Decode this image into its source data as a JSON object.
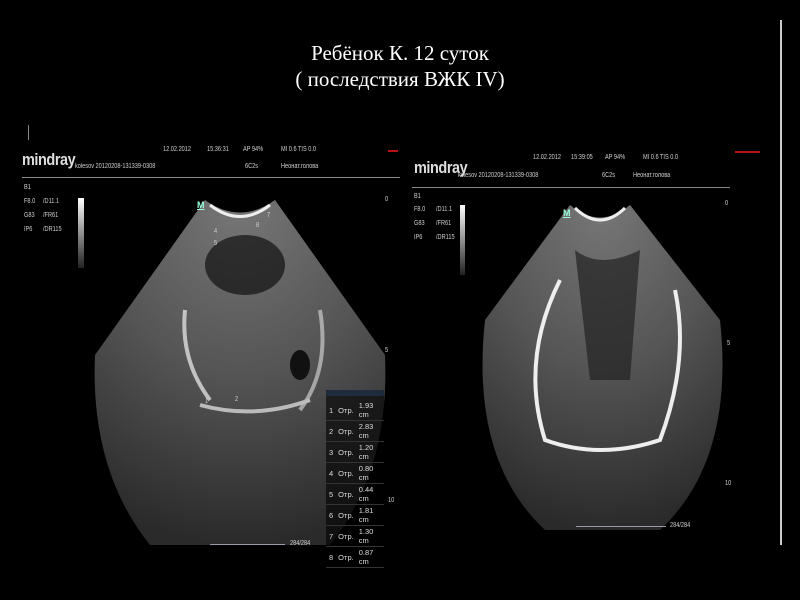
{
  "title": {
    "line1": "Ребёнок К. 12 суток",
    "line2": "( последствия ВЖК IV)"
  },
  "left": {
    "logo": "mindray",
    "date": "12.02.2012",
    "time": "15:36:31",
    "ap": "AP 94%",
    "mi": "MI 0.6 TIS 0.0",
    "patient": "kolesov 20120208-131339-0308",
    "probe": "6C2s",
    "preset": "Неонат.голова",
    "params": [
      "B1",
      "F8.0",
      "/D11.1",
      "G83",
      "/FR61",
      "IP6",
      "/DR115"
    ],
    "marker": "M",
    "depth": [
      "0",
      "5",
      "10"
    ],
    "scale": "284/284",
    "labels": [
      "1",
      "2",
      "4",
      "5",
      "7",
      "8"
    ],
    "measurements": [
      {
        "n": "1",
        "t": "Отр.",
        "v": "1.93 cm"
      },
      {
        "n": "2",
        "t": "Отр.",
        "v": "2.83 cm"
      },
      {
        "n": "3",
        "t": "Отр.",
        "v": "1.20 cm"
      },
      {
        "n": "4",
        "t": "Отр.",
        "v": "0.80 cm"
      },
      {
        "n": "5",
        "t": "Отр.",
        "v": "0.44 cm"
      },
      {
        "n": "6",
        "t": "Отр.",
        "v": "1.81 cm"
      },
      {
        "n": "7",
        "t": "Отр.",
        "v": "1.30 cm"
      },
      {
        "n": "8",
        "t": "Отр.",
        "v": "0.87 cm"
      }
    ]
  },
  "right": {
    "logo": "mindray",
    "date": "12.02.2012",
    "time": "15:39:05",
    "ap": "AP 94%",
    "mi": "MI 0.6 TIS 0.0",
    "patient": "kolesov 20120208-131339-0308",
    "probe": "6C2s",
    "preset": "Неонат.голова",
    "params": [
      "B1",
      "F8.0",
      "/D11.1",
      "G83",
      "/FR61",
      "IP6",
      "/DR115"
    ],
    "marker": "M",
    "depth": [
      "0",
      "5",
      "10"
    ],
    "scale": "284/284"
  }
}
